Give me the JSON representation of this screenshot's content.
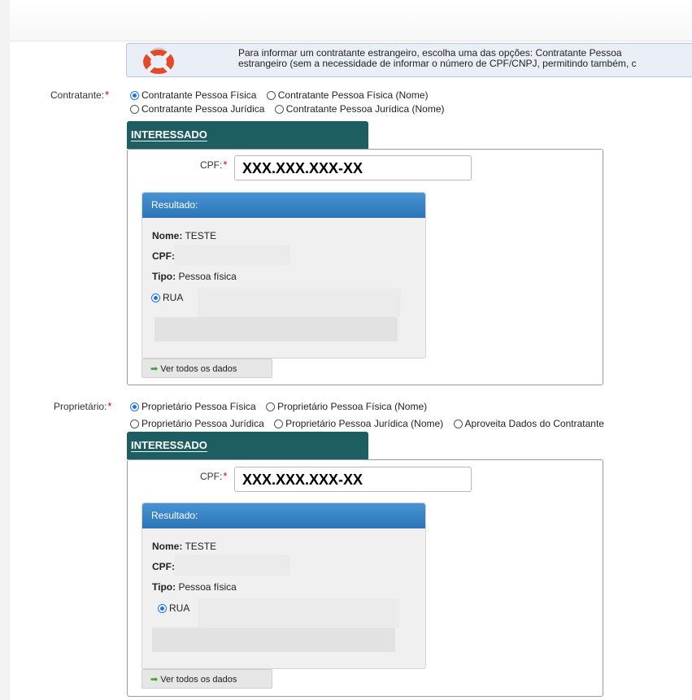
{
  "info": {
    "icon": "lifebuoy-icon",
    "line1": "Para informar um contratante estrangeiro, escolha uma das opções: Contratante Pessoa",
    "line2": "estrangeiro (sem a necessidade de informar o número de CPF/CNPJ, permitindo também, c"
  },
  "contratante": {
    "label": "Contratante:",
    "required": "*",
    "options_row1": [
      "Contratante Pessoa Física",
      "Contratante Pessoa Física (Nome)"
    ],
    "options_row2": [
      "Contratante Pessoa Jurídica",
      "Contratante Pessoa Jurídica (Nome)"
    ],
    "selected": "Contratante Pessoa Física",
    "tab": "INTERESSADO",
    "cpf_label": "CPF:",
    "cpf_value": "XXX.XXX.XXX-XX",
    "result": {
      "header": "Resultado:",
      "nome_label": "Nome:",
      "nome_value": "TESTE",
      "cpf_label": "CPF:",
      "tipo_label": "Tipo:",
      "tipo_value": "Pessoa física",
      "address": "RUA",
      "button": "Ver todos os dados"
    }
  },
  "proprietario": {
    "label": "Proprietário:",
    "required": "*",
    "options_row1": [
      "Proprietário Pessoa Física",
      "Proprietário Pessoa Física (Nome)"
    ],
    "options_row2": [
      "Proprietário Pessoa Jurídica",
      "Proprietário Pessoa Jurídica (Nome)",
      "Aproveita Dados do Contratante"
    ],
    "selected": "Proprietário Pessoa Física",
    "tab": "INTERESSADO",
    "cpf_label": "CPF:",
    "cpf_value": "XXX.XXX.XXX-XX",
    "result": {
      "header": "Resultado:",
      "nome_label": "Nome:",
      "nome_value": "TESTE",
      "cpf_label": "CPF:",
      "tipo_label": "Tipo:",
      "tipo_value": "Pessoa física",
      "address": "RUA",
      "button": "Ver todos os dados"
    }
  },
  "colors": {
    "tab_bg": "#1d5e63",
    "result_header": "#3a84c5",
    "radio_selected": "#1a73e8",
    "required": "#dd0000"
  }
}
